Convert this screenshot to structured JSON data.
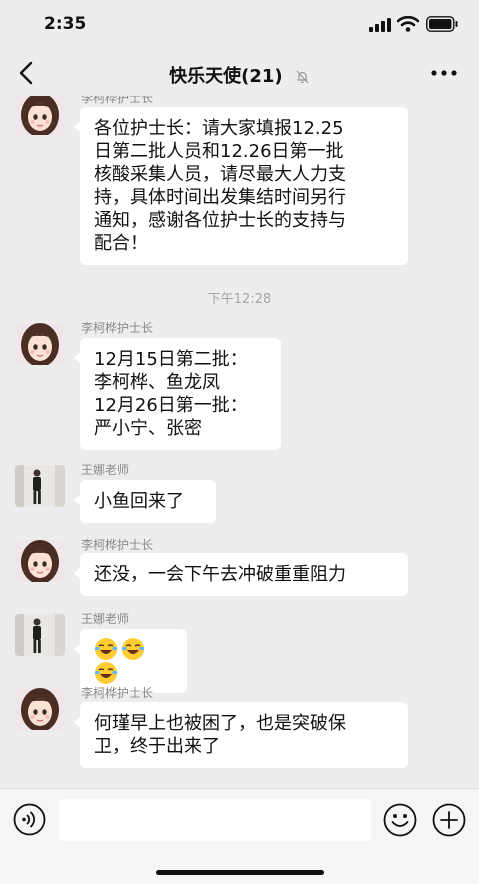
{
  "status_bar": {
    "time": "2:35"
  },
  "header": {
    "title": "快乐天使(21)"
  },
  "messages": [
    {
      "sender": "李柯桦护士长",
      "avatar": "cartoon-girl-avatar",
      "lines": [
        "各位护士长：请大家填报12.25",
        "日第二批人员和12.26日第一批",
        "核酸采集人员，请尽最大人力支",
        "持，具体时间出发集结时间另行",
        "通知，感谢各位护士长的支持与",
        "配合！"
      ]
    },
    {
      "timestamp": "下午12:28"
    },
    {
      "sender": "李柯桦护士长",
      "avatar": "cartoon-girl-avatar",
      "lines": [
        "12月15日第二批：",
        "李柯桦、鱼龙凤",
        "12月26日第一批：",
        "严小宁、张密"
      ]
    },
    {
      "sender": "王娜老师",
      "avatar": "photo-avatar",
      "lines": [
        "小鱼回来了"
      ]
    },
    {
      "sender": "李柯桦护士长",
      "avatar": "cartoon-girl-avatar",
      "lines": [
        "还没，一会下午去冲破重重阻力"
      ]
    },
    {
      "sender": "王娜老师",
      "avatar": "photo-avatar",
      "emoji": [
        "laugh-cry-emoji",
        "laugh-cry-emoji",
        "laugh-cry-emoji"
      ]
    },
    {
      "sender": "李柯桦护士长",
      "avatar": "cartoon-girl-avatar",
      "lines": [
        "何瑾早上也被困了，也是突破保",
        "卫，终于出来了"
      ]
    }
  ],
  "input_bar": {
    "value": "",
    "placeholder": ""
  },
  "icons": {
    "back": "chevron-left-icon",
    "mute": "bell-slash-icon",
    "more": "more-dots-icon",
    "voice": "voice-icon",
    "emoji": "smiley-icon",
    "plus": "plus-icon"
  }
}
